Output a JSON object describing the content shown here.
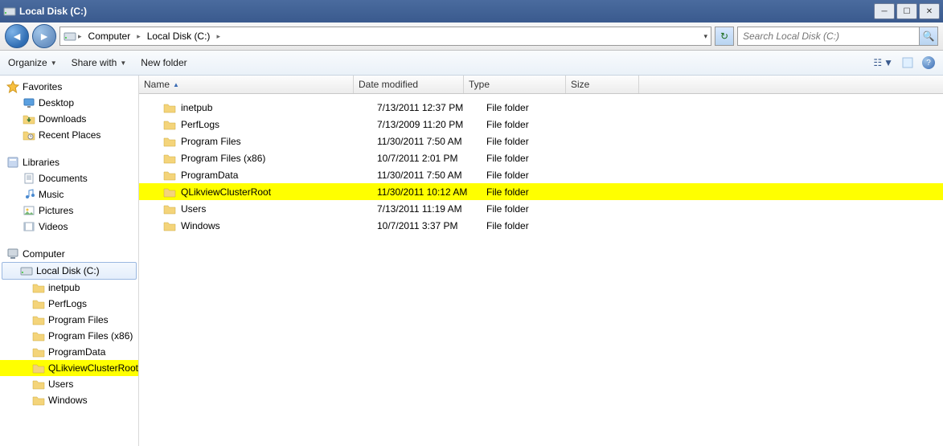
{
  "window": {
    "title": "Local Disk (C:)"
  },
  "breadcrumb": {
    "segments": [
      "Computer",
      "Local Disk (C:)"
    ]
  },
  "search": {
    "placeholder": "Search Local Disk (C:)"
  },
  "toolbar": {
    "organize": "Organize",
    "share": "Share with",
    "newfolder": "New folder"
  },
  "columns": {
    "name": "Name",
    "date": "Date modified",
    "type": "Type",
    "size": "Size"
  },
  "tree": {
    "favorites": "Favorites",
    "fav_items": [
      "Desktop",
      "Downloads",
      "Recent Places"
    ],
    "libraries": "Libraries",
    "lib_items": [
      "Documents",
      "Music",
      "Pictures",
      "Videos"
    ],
    "computer": "Computer",
    "drive": "Local Disk (C:)",
    "drive_items": [
      "inetpub",
      "PerfLogs",
      "Program Files",
      "Program Files (x86)",
      "ProgramData",
      "QLikviewClusterRoot",
      "Users",
      "Windows"
    ],
    "highlight_index": 5
  },
  "files": [
    {
      "name": "inetpub",
      "date": "7/13/2011 12:37 PM",
      "type": "File folder",
      "size": "",
      "hl": false
    },
    {
      "name": "PerfLogs",
      "date": "7/13/2009 11:20 PM",
      "type": "File folder",
      "size": "",
      "hl": false
    },
    {
      "name": "Program Files",
      "date": "11/30/2011 7:50 AM",
      "type": "File folder",
      "size": "",
      "hl": false
    },
    {
      "name": "Program Files (x86)",
      "date": "10/7/2011 2:01 PM",
      "type": "File folder",
      "size": "",
      "hl": false
    },
    {
      "name": "ProgramData",
      "date": "11/30/2011 7:50 AM",
      "type": "File folder",
      "size": "",
      "hl": false
    },
    {
      "name": "QLikviewClusterRoot",
      "date": "11/30/2011 10:12 AM",
      "type": "File folder",
      "size": "",
      "hl": true
    },
    {
      "name": "Users",
      "date": "7/13/2011 11:19 AM",
      "type": "File folder",
      "size": "",
      "hl": false
    },
    {
      "name": "Windows",
      "date": "10/7/2011 3:37 PM",
      "type": "File folder",
      "size": "",
      "hl": false
    }
  ]
}
